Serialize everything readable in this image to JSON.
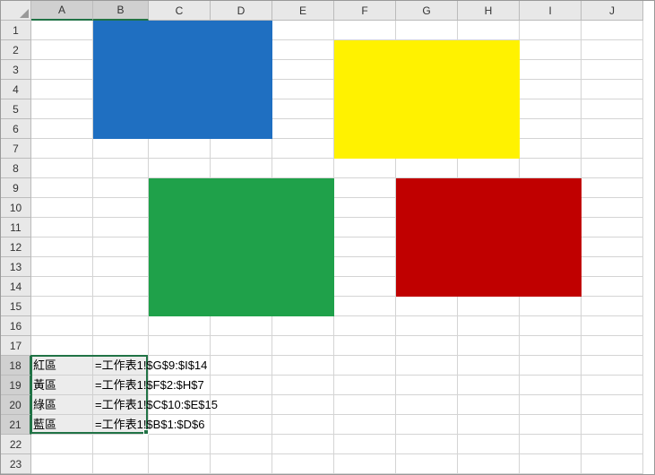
{
  "columns": [
    "A",
    "B",
    "C",
    "D",
    "E",
    "F",
    "G",
    "H",
    "I",
    "J"
  ],
  "row_count": 23,
  "selected_cols": [
    "A",
    "B"
  ],
  "selected_rows": [
    18,
    19,
    20,
    21
  ],
  "shapes": [
    {
      "name": "blue-rect",
      "color": "#1f6fc1",
      "col_start": 2,
      "col_end": 4,
      "row_start": 1,
      "row_end": 6
    },
    {
      "name": "yellow-rect",
      "color": "#fff200",
      "col_start": 6,
      "col_end": 8,
      "row_start": 2,
      "row_end": 7
    },
    {
      "name": "green-rect",
      "color": "#1fa14a",
      "col_start": 3,
      "col_end": 5,
      "row_start": 9,
      "row_end": 15
    },
    {
      "name": "red-rect",
      "color": "#c00000",
      "col_start": 7,
      "col_end": 9,
      "row_start": 9,
      "row_end": 14
    }
  ],
  "table": {
    "rows": [
      {
        "row": 18,
        "label": "紅區",
        "formula": "=工作表1!$G$9:$I$14"
      },
      {
        "row": 19,
        "label": "黃區",
        "formula": "=工作表1!$F$2:$H$7"
      },
      {
        "row": 20,
        "label": "綠區",
        "formula": "=工作表1!$C$10:$E$15"
      },
      {
        "row": 21,
        "label": "藍區",
        "formula": "=工作表1!$B$1:$D$6"
      }
    ]
  }
}
